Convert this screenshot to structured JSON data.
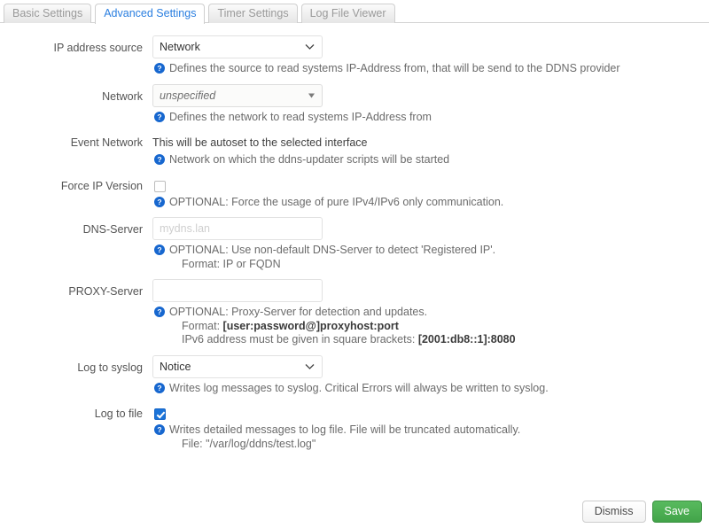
{
  "tabs": [
    {
      "label": "Basic Settings",
      "active": false
    },
    {
      "label": "Advanced Settings",
      "active": true
    },
    {
      "label": "Timer Settings",
      "active": false
    },
    {
      "label": "Log File Viewer",
      "active": false
    }
  ],
  "colors": {
    "accent_blue": "#2b7fe0",
    "help_icon_blue": "#1767cf",
    "save_green": "#46a84e",
    "checkbox_blue": "#1a73d8"
  },
  "rows": {
    "ip_address_source": {
      "label": "IP address source",
      "value": "Network",
      "help": "Defines the source to read systems IP-Address from, that will be send to the DDNS provider"
    },
    "network": {
      "label": "Network",
      "value": "unspecified",
      "help": "Defines the network to read systems IP-Address from"
    },
    "event_network": {
      "label": "Event Network",
      "value": "This will be autoset to the selected interface",
      "help": "Network on which the ddns-updater scripts will be started"
    },
    "force_ip_version": {
      "label": "Force IP Version",
      "checked": false,
      "help": "OPTIONAL: Force the usage of pure IPv4/IPv6 only communication."
    },
    "dns_server": {
      "label": "DNS-Server",
      "value": "",
      "placeholder": "mydns.lan",
      "help_line1": "OPTIONAL: Use non-default DNS-Server to detect 'Registered IP'.",
      "help_line2": "Format: IP or FQDN"
    },
    "proxy_server": {
      "label": "PROXY-Server",
      "value": "",
      "placeholder": "",
      "help_line1": "OPTIONAL: Proxy-Server for detection and updates.",
      "help_line2_prefix": "Format: ",
      "help_line2_bold": "[user:password@]proxyhost:port",
      "help_line3_prefix": "IPv6 address must be given in square brackets: ",
      "help_line3_bold": "[2001:db8::1]:8080"
    },
    "log_to_syslog": {
      "label": "Log to syslog",
      "value": "Notice",
      "help": "Writes log messages to syslog. Critical Errors will always be written to syslog."
    },
    "log_to_file": {
      "label": "Log to file",
      "checked": true,
      "help_line1": "Writes detailed messages to log file. File will be truncated automatically.",
      "help_line2": "File: \"/var/log/ddns/test.log\""
    }
  },
  "footer": {
    "dismiss_label": "Dismiss",
    "save_label": "Save"
  }
}
